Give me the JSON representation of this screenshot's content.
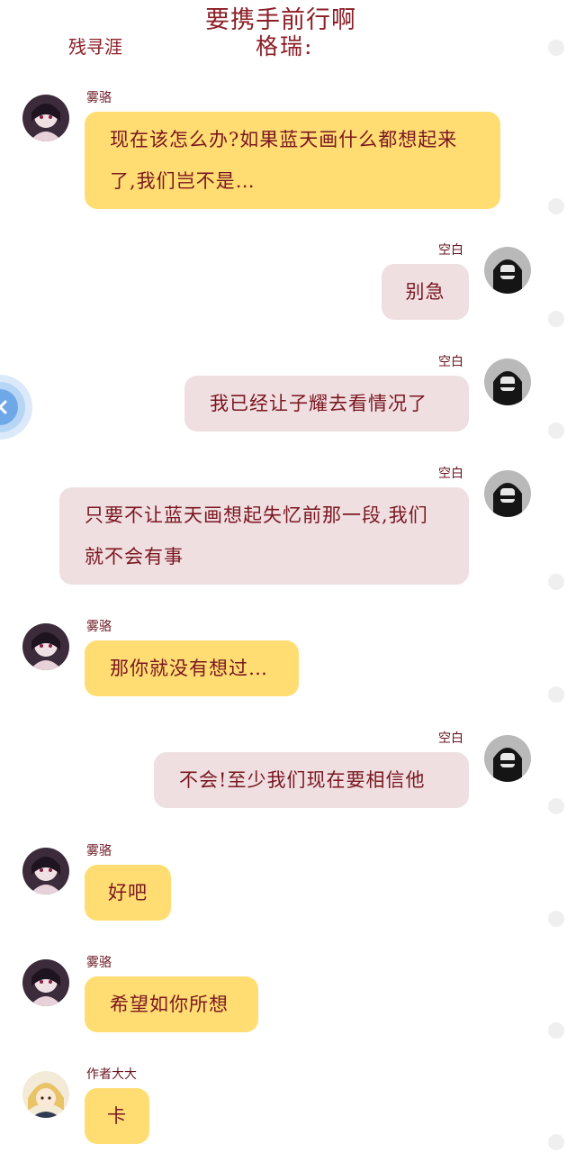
{
  "header": {
    "title_line1": "要携手前行啊",
    "title_line2": "格瑞:",
    "author": "残寻涯"
  },
  "messages": [
    {
      "sender": "雾骆",
      "text": "现在该怎么办?如果蓝天画什么都想起来了,我们岂不是…",
      "side": "left",
      "avatar": "wuluo-avatar"
    },
    {
      "sender": "空白",
      "text": "别急",
      "side": "right",
      "avatar": "kongbai-avatar"
    },
    {
      "sender": "空白",
      "text": "我已经让子耀去看情况了",
      "side": "right",
      "avatar": "kongbai-avatar"
    },
    {
      "sender": "空白",
      "text": "只要不让蓝天画想起失忆前那一段,我们就不会有事",
      "side": "right",
      "avatar": "kongbai-avatar"
    },
    {
      "sender": "雾骆",
      "text": "那你就没有想过…",
      "side": "left",
      "avatar": "wuluo-avatar"
    },
    {
      "sender": "空白",
      "text": "不会!至少我们现在要相信他",
      "side": "right",
      "avatar": "kongbai-avatar"
    },
    {
      "sender": "雾骆",
      "text": "好吧",
      "side": "left",
      "avatar": "wuluo-avatar"
    },
    {
      "sender": "雾骆",
      "text": "希望如你所想",
      "side": "left",
      "avatar": "wuluo-avatar"
    },
    {
      "sender": "作者大大",
      "text": "卡",
      "side": "left",
      "avatar": "author-avatar"
    }
  ],
  "colors": {
    "left_bubble": "#ffdd73",
    "right_bubble": "#f0dfe1",
    "text": "#7a1620"
  },
  "icons": {
    "float_button": "close-x-icon"
  }
}
